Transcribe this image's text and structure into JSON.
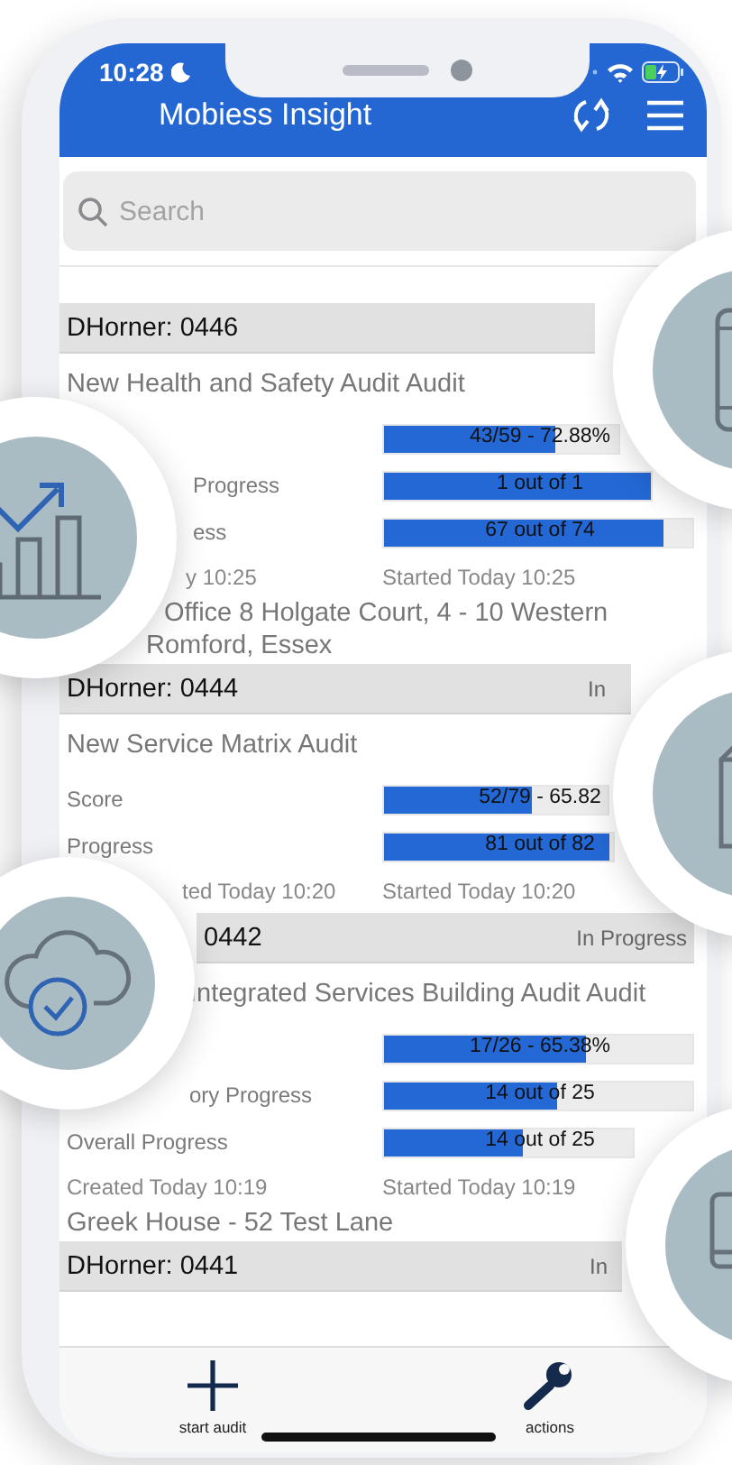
{
  "status_bar": {
    "time": "10:28"
  },
  "header": {
    "title": "Mobiess Insight"
  },
  "search": {
    "placeholder": "Search"
  },
  "audits": [
    {
      "header": "DHorner: 0446",
      "title": "New Health and Safety Audit Audit",
      "metrics": [
        {
          "reading": "43/59 - 72.88%",
          "level": 0.729
        },
        {
          "label": "Progress",
          "reading": "1 out of 1",
          "level": 1
        },
        {
          "label": "ess",
          "reading": "67 out of 74",
          "level": 0.905
        }
      ],
      "created": "y 10:25",
      "started": "Started Today 10:25",
      "address": [
        "Office 8 Holgate Court, 4 - 10 Western",
        "Romford, Essex"
      ]
    },
    {
      "header": "DHorner: 0444",
      "status": "In",
      "title": "New Service Matrix Audit",
      "metrics": [
        {
          "label": "Score",
          "reading": "52/79 - 65.82",
          "level": 0.658
        },
        {
          "label": "Progress",
          "reading": "81 out of 82",
          "level": 0.988
        }
      ],
      "created": "ted Today 10:20",
      "started": "Started Today 10:20"
    },
    {
      "header": "0442",
      "status": "In Progress",
      "title": "Integrated Services Building Audit Audit",
      "metrics": [
        {
          "reading": "17/26 - 65.38%",
          "level": 0.654
        },
        {
          "label": "ory Progress",
          "reading": "14 out of 25",
          "level": 0.56
        },
        {
          "label": "Overall Progress",
          "reading": "14 out of 25",
          "level": 0.56
        }
      ],
      "created": "Created Today 10:19",
      "started": "Started Today 10:19",
      "address": [
        "Greek House - 52 Test Lane"
      ]
    },
    {
      "header": "DHorner: 0441",
      "status": "In"
    }
  ],
  "tab_bar": {
    "items": [
      {
        "kind": "add",
        "label": "start audit"
      },
      {
        "kind": "wrench",
        "label": "actions"
      }
    ]
  }
}
